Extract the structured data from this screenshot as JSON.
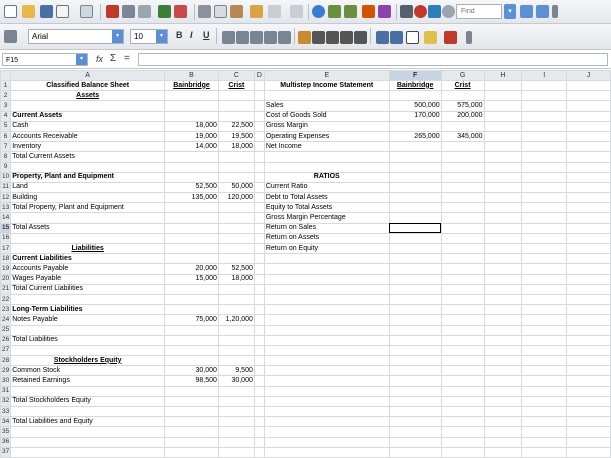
{
  "find": {
    "placeholder": "Find"
  },
  "format": {
    "font_name": "Arial",
    "font_size": "10",
    "bold": "B",
    "italic": "I",
    "underline": "U"
  },
  "formula_bar": {
    "cell_ref": "F15",
    "fx": "fx",
    "sum": "Σ",
    "equals": "="
  },
  "columns": [
    "A",
    "B",
    "C",
    "D",
    "E",
    "F",
    "G",
    "H",
    "I",
    "J"
  ],
  "active_cell": {
    "row": 15,
    "col": "F"
  },
  "rows": [
    {
      "n": "1",
      "A": "Classified Balance Sheet",
      "B": "Bainbridge",
      "C": "Crist",
      "E": "Multistep Income Statement",
      "F": "Bainbridge",
      "G": "Crist"
    },
    {
      "n": "2",
      "A": "Assets"
    },
    {
      "n": "3",
      "E": "Sales",
      "F": "500,000",
      "G": "575,000"
    },
    {
      "n": "4",
      "A": "Current Assets",
      "E": "Cost of Goods Sold",
      "F": "170,000",
      "G": "200,000"
    },
    {
      "n": "5",
      "A": "Cash",
      "B": "18,000",
      "C": "22,500",
      "E": "Gross Margin"
    },
    {
      "n": "6",
      "A": "Accounts Receivable",
      "B": "19,000",
      "C": "19,500",
      "E": "Operating Expenses",
      "F": "265,000",
      "G": "345,000"
    },
    {
      "n": "7",
      "A": "Inventory",
      "B": "14,000",
      "C": "18,000",
      "E": "Net Income"
    },
    {
      "n": "8",
      "A": "Total Current Assets"
    },
    {
      "n": "9"
    },
    {
      "n": "10",
      "A": "Property, Plant and Equipment",
      "E": "RATIOS"
    },
    {
      "n": "11",
      "A": "Land",
      "B": "52,500",
      "C": "50,000",
      "E": "Current Ratio"
    },
    {
      "n": "12",
      "A": "Building",
      "B": "135,000",
      "C": "120,000",
      "E": "Debt to Total Assets"
    },
    {
      "n": "13",
      "A": "Total Property, Plant and Equipment",
      "E": "Equity to Total Assets"
    },
    {
      "n": "14",
      "E": "Gross Margin Percentage"
    },
    {
      "n": "15",
      "A": "Total Assets",
      "E": "Return on Sales"
    },
    {
      "n": "16",
      "E": "Return on Assets"
    },
    {
      "n": "17",
      "A": "Liabilities",
      "E": "Return on Equity"
    },
    {
      "n": "18",
      "A": "Current Liabilities"
    },
    {
      "n": "19",
      "A": "Accounts Payable",
      "B": "20,000",
      "C": "52,500"
    },
    {
      "n": "20",
      "A": "Wages Payable",
      "B": "15,000",
      "C": "18,000"
    },
    {
      "n": "21",
      "A": "Total Current Liabilities"
    },
    {
      "n": "22"
    },
    {
      "n": "23",
      "A": "Long-Term Liabilities"
    },
    {
      "n": "24",
      "A": "Notes Payable",
      "B": "75,000",
      "C": "1,20,000"
    },
    {
      "n": "25"
    },
    {
      "n": "26",
      "A": "Total Liabilities"
    },
    {
      "n": "27"
    },
    {
      "n": "28",
      "A": "Stockholders Equity"
    },
    {
      "n": "29",
      "A": "Common Stock",
      "B": "30,000",
      "C": "9,500"
    },
    {
      "n": "30",
      "A": "Retained Earnings",
      "B": "98,500",
      "C": "30,000"
    },
    {
      "n": "31"
    },
    {
      "n": "32",
      "A": "Total Stockholders Equity"
    },
    {
      "n": "33"
    },
    {
      "n": "34",
      "A": "Total Liabilities and Equity"
    },
    {
      "n": "35"
    },
    {
      "n": "36"
    },
    {
      "n": "37"
    }
  ]
}
